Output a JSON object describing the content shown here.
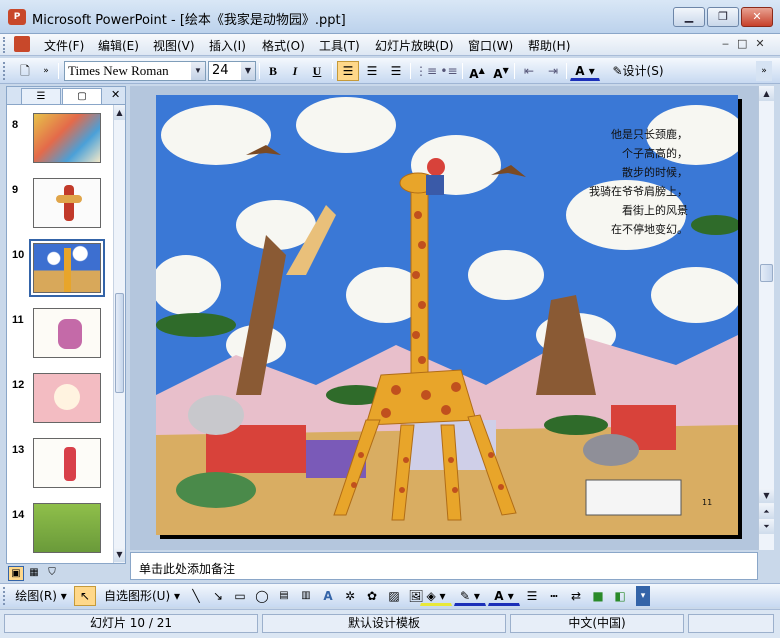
{
  "window": {
    "title": "Microsoft PowerPoint - [绘本《我家是动物园》.ppt]",
    "app_badge": "P"
  },
  "menu": [
    "文件(F)",
    "编辑(E)",
    "视图(V)",
    "插入(I)",
    "格式(O)",
    "工具(T)",
    "幻灯片放映(D)",
    "窗口(W)",
    "帮助(H)"
  ],
  "toolbar": {
    "font": "Times New Roman",
    "size": "24",
    "bold": "B",
    "italic": "I",
    "underline": "U",
    "design_label": "设计(S)"
  },
  "slides": [
    {
      "num": "8"
    },
    {
      "num": "9"
    },
    {
      "num": "10",
      "selected": true
    },
    {
      "num": "11"
    },
    {
      "num": "12"
    },
    {
      "num": "13"
    },
    {
      "num": "14"
    }
  ],
  "slide_text": {
    "lines": [
      "他是只长颈鹿，",
      "个子高高的，",
      "散步的时候，",
      "我骑在爷爷肩膀上，",
      "看街上的风景",
      "在不停地变幻。"
    ],
    "page_number": "11"
  },
  "notes_placeholder": "单击此处添加备注",
  "drawing": {
    "draw_label": "绘图(R)",
    "autoshapes_label": "自选图形(U)"
  },
  "status": {
    "slide_position": "幻灯片 10 / 21",
    "template": "默认设计模板",
    "language": "中文(中国)"
  }
}
